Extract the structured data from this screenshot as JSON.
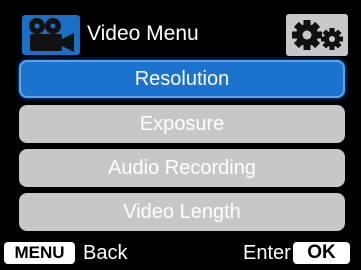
{
  "header": {
    "icon": "video-camera-icon",
    "title": "Video Menu",
    "settings_icon": "gear-icon"
  },
  "menu": {
    "items": [
      {
        "label": "Resolution",
        "selected": true
      },
      {
        "label": "Exposure",
        "selected": false
      },
      {
        "label": "Audio Recording",
        "selected": false
      },
      {
        "label": "Video Length",
        "selected": false
      }
    ]
  },
  "footer": {
    "menu_key": "MENU",
    "back_label": "Back",
    "enter_label": "Enter",
    "ok_key": "OK"
  },
  "colors": {
    "background": "#000000",
    "selected": "#1b73cf",
    "item": "#c7c7c7",
    "text": "#ffffff"
  }
}
